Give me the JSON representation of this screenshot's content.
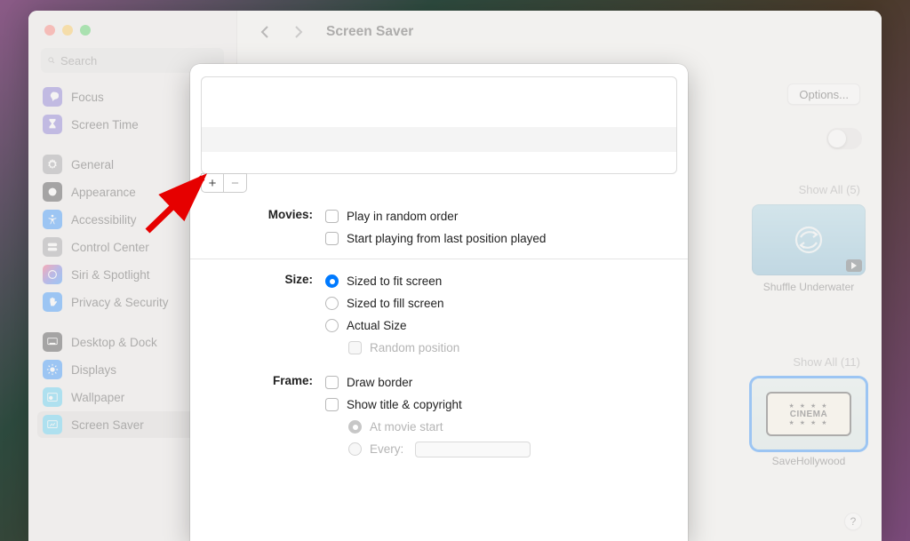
{
  "window_title": "Screen Saver",
  "search_placeholder": "Search",
  "sidebar": {
    "items": [
      {
        "label": "Focus"
      },
      {
        "label": "Screen Time"
      },
      {
        "label": "General"
      },
      {
        "label": "Appearance"
      },
      {
        "label": "Accessibility"
      },
      {
        "label": "Control Center"
      },
      {
        "label": "Siri & Spotlight"
      },
      {
        "label": "Privacy & Security"
      },
      {
        "label": "Desktop & Dock"
      },
      {
        "label": "Displays"
      },
      {
        "label": "Wallpaper"
      },
      {
        "label": "Screen Saver"
      }
    ]
  },
  "main": {
    "options_label": "Options...",
    "show_all_1": "Show All (5)",
    "show_all_2": "Show All (11)",
    "thumb1": "Shuffle Underwater",
    "thumb2": "SaveHollywood",
    "cinema_label": "CINEMA"
  },
  "modal": {
    "sections": {
      "movies": {
        "label": "Movies:",
        "opts": {
          "random": "Play in random order",
          "resume": "Start playing from last position played"
        }
      },
      "size": {
        "label": "Size:",
        "opts": {
          "fit": "Sized to fit screen",
          "fill": "Sized to fill screen",
          "actual": "Actual Size",
          "random_pos": "Random position"
        }
      },
      "frame": {
        "label": "Frame:",
        "opts": {
          "border": "Draw border",
          "title": "Show title & copyright",
          "at_start": "At movie start",
          "every": "Every:"
        }
      }
    }
  }
}
